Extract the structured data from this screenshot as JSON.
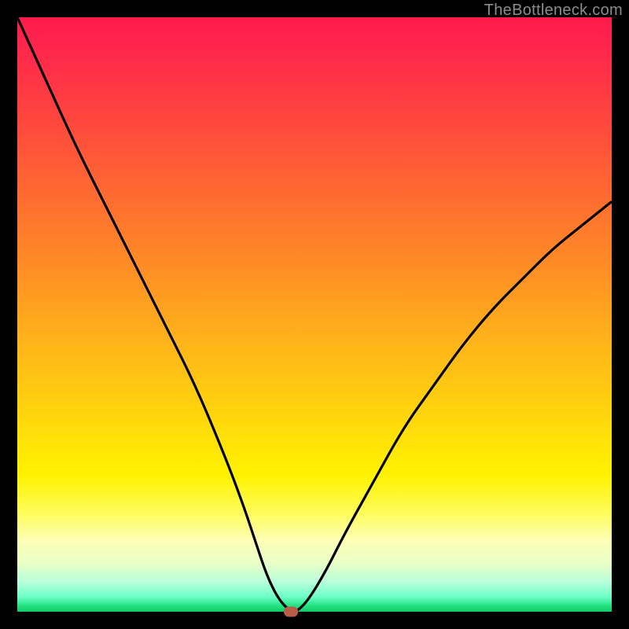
{
  "watermark": "TheBottleneck.com",
  "chart_data": {
    "type": "line",
    "title": "",
    "xlabel": "",
    "ylabel": "",
    "xlim": [
      0,
      100
    ],
    "ylim": [
      0,
      100
    ],
    "legend": false,
    "grid": false,
    "background": "vertical-gradient red→green",
    "series": [
      {
        "name": "bottleneck-curve",
        "x": [
          0,
          5,
          10,
          15,
          20,
          25,
          30,
          35,
          38,
          40,
          42,
          44,
          46,
          47,
          49,
          52,
          55,
          60,
          65,
          70,
          75,
          80,
          85,
          90,
          95,
          100
        ],
        "y": [
          100,
          89,
          78,
          68,
          58,
          48,
          38,
          26,
          18,
          12,
          6,
          2,
          0,
          0,
          2,
          7,
          13,
          22,
          31,
          38,
          45,
          51,
          56,
          61,
          65,
          69
        ]
      }
    ],
    "marker": {
      "x": 46,
      "y": 0,
      "color": "#b85c4a"
    }
  },
  "colors": {
    "frame": "#000000",
    "curve": "#000000",
    "marker": "#b85c4a"
  }
}
